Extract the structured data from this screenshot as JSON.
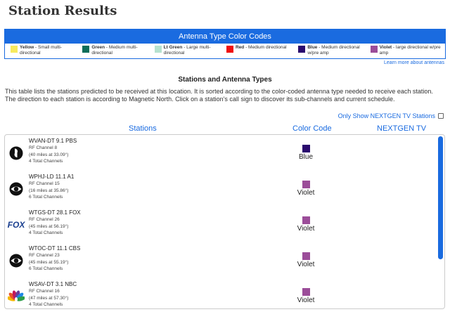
{
  "page": {
    "title": "Station Results"
  },
  "legend": {
    "header": "Antenna Type Color Codes",
    "items": [
      {
        "name": "Yellow",
        "desc": " - Small multi-directional",
        "color": "#f7ea5e"
      },
      {
        "name": "Green",
        "desc": " - Medium multi-directional",
        "color": "#0c6e5a"
      },
      {
        "name": "Lt Green",
        "desc": " - Large multi-directional",
        "color": "#b6e2cf"
      },
      {
        "name": "Red",
        "desc": " - Medium directional",
        "color": "#f00f0f"
      },
      {
        "name": "Blue",
        "desc": " - Medium directional w/pre amp",
        "color": "#2a0a6e"
      },
      {
        "name": "Violet",
        "desc": " - large directional w/pre amp",
        "color": "#9b4d99"
      }
    ],
    "learn_more": "Learn more about antennas"
  },
  "section": {
    "title": "Stations and Antenna Types",
    "description": "This table lists the stations predicted to be received at this location. It is sorted according to the color-coded antenna type needed to receive each station. The direction to each station is according to Magnetic North. Click on a station's call sign to discover its sub-channels and current schedule."
  },
  "filter": {
    "label": "Only Show NEXTGEN TV Stations"
  },
  "table": {
    "columns": {
      "stations": "Stations",
      "color_code": "Color Code",
      "nextgen": "NEXTGEN TV"
    },
    "rows": [
      {
        "call": "WVAN-DT 9.1 PBS",
        "rf": "RF Channel 8",
        "dist": "(40 miles at 33.09°)",
        "total": "4 Total Channels",
        "network_icon": "pbs-logo-icon",
        "color_name": "Blue",
        "color": "#2a0a6e"
      },
      {
        "call": "WPHJ-LD 11.1 A1",
        "rf": "RF Channel 15",
        "dist": "(16 miles at 35.86°)",
        "total": "6 Total Channels",
        "network_icon": "cbs-eye-logo-icon",
        "color_name": "Violet",
        "color": "#9b4d99"
      },
      {
        "call": "WTGS-DT 28.1 FOX",
        "rf": "RF Channel 26",
        "dist": "(45 miles at 56.19°)",
        "total": "4 Total Channels",
        "network_icon": "fox-logo-icon",
        "logo_text": "FOX",
        "color_name": "Violet",
        "color": "#9b4d99"
      },
      {
        "call": "WTOC-DT 11.1 CBS",
        "rf": "RF Channel 23",
        "dist": "(45 miles at 55.19°)",
        "total": "6 Total Channels",
        "network_icon": "cbs-eye-logo-icon",
        "color_name": "Violet",
        "color": "#9b4d99"
      },
      {
        "call": "WSAV-DT 3.1 NBC",
        "rf": "RF Channel 16",
        "dist": "(47 miles at 57.30°)",
        "total": "4 Total Channels",
        "network_icon": "nbc-peacock-logo-icon",
        "color_name": "Violet",
        "color": "#9b4d99"
      }
    ]
  }
}
